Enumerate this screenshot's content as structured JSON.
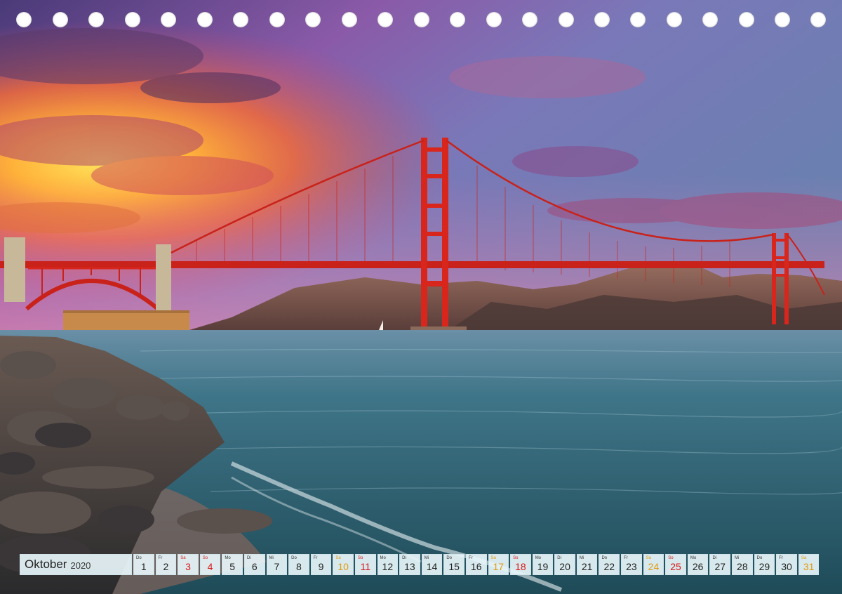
{
  "calendar": {
    "month": "Oktober",
    "year": "2020",
    "days": [
      {
        "wd": "Do",
        "n": "1",
        "type": "norm"
      },
      {
        "wd": "Fr",
        "n": "2",
        "type": "norm"
      },
      {
        "wd": "Sa",
        "n": "3",
        "type": "hol"
      },
      {
        "wd": "So",
        "n": "4",
        "type": "sun"
      },
      {
        "wd": "Mo",
        "n": "5",
        "type": "norm"
      },
      {
        "wd": "Di",
        "n": "6",
        "type": "norm"
      },
      {
        "wd": "Mi",
        "n": "7",
        "type": "norm"
      },
      {
        "wd": "Do",
        "n": "8",
        "type": "norm"
      },
      {
        "wd": "Fr",
        "n": "9",
        "type": "norm"
      },
      {
        "wd": "Sa",
        "n": "10",
        "type": "sat"
      },
      {
        "wd": "So",
        "n": "11",
        "type": "sun"
      },
      {
        "wd": "Mo",
        "n": "12",
        "type": "norm"
      },
      {
        "wd": "Di",
        "n": "13",
        "type": "norm"
      },
      {
        "wd": "Mi",
        "n": "14",
        "type": "norm"
      },
      {
        "wd": "Do",
        "n": "15",
        "type": "norm"
      },
      {
        "wd": "Fr",
        "n": "16",
        "type": "norm"
      },
      {
        "wd": "Sa",
        "n": "17",
        "type": "sat"
      },
      {
        "wd": "So",
        "n": "18",
        "type": "sun"
      },
      {
        "wd": "Mo",
        "n": "19",
        "type": "norm"
      },
      {
        "wd": "Di",
        "n": "20",
        "type": "norm"
      },
      {
        "wd": "Mi",
        "n": "21",
        "type": "norm"
      },
      {
        "wd": "Do",
        "n": "22",
        "type": "norm"
      },
      {
        "wd": "Fr",
        "n": "23",
        "type": "norm"
      },
      {
        "wd": "Sa",
        "n": "24",
        "type": "sat"
      },
      {
        "wd": "So",
        "n": "25",
        "type": "sun"
      },
      {
        "wd": "Mo",
        "n": "26",
        "type": "norm"
      },
      {
        "wd": "Di",
        "n": "27",
        "type": "norm"
      },
      {
        "wd": "Mi",
        "n": "28",
        "type": "norm"
      },
      {
        "wd": "Do",
        "n": "29",
        "type": "norm"
      },
      {
        "wd": "Fr",
        "n": "30",
        "type": "norm"
      },
      {
        "wd": "Sa",
        "n": "31",
        "type": "sat"
      }
    ]
  },
  "colors": {
    "saturday": "#e09a10",
    "sunday_holiday": "#d81818",
    "bridge": "#d8261c"
  }
}
